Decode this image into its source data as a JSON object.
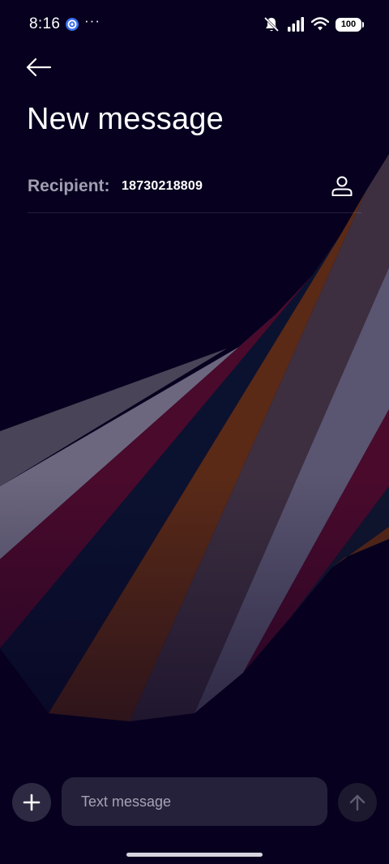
{
  "status_bar": {
    "time": "8:16",
    "more": "···",
    "battery_level": "100",
    "icons": [
      "app-notification-icon",
      "silent-bell-icon",
      "signal-icon",
      "wifi-icon",
      "battery-icon"
    ]
  },
  "header": {
    "back_icon": "arrow-left-icon",
    "title": "New message"
  },
  "recipient": {
    "label": "Recipient:",
    "value": "18730218809",
    "contact_icon": "person-icon"
  },
  "composer": {
    "attach_icon": "plus-icon",
    "message_placeholder": "Text message",
    "message_value": "",
    "send_icon": "arrow-up-icon"
  },
  "colors": {
    "background": "#07011f",
    "input_bg": "#26213a",
    "button_bg": "#2d2942",
    "label": "#a19eb2"
  }
}
